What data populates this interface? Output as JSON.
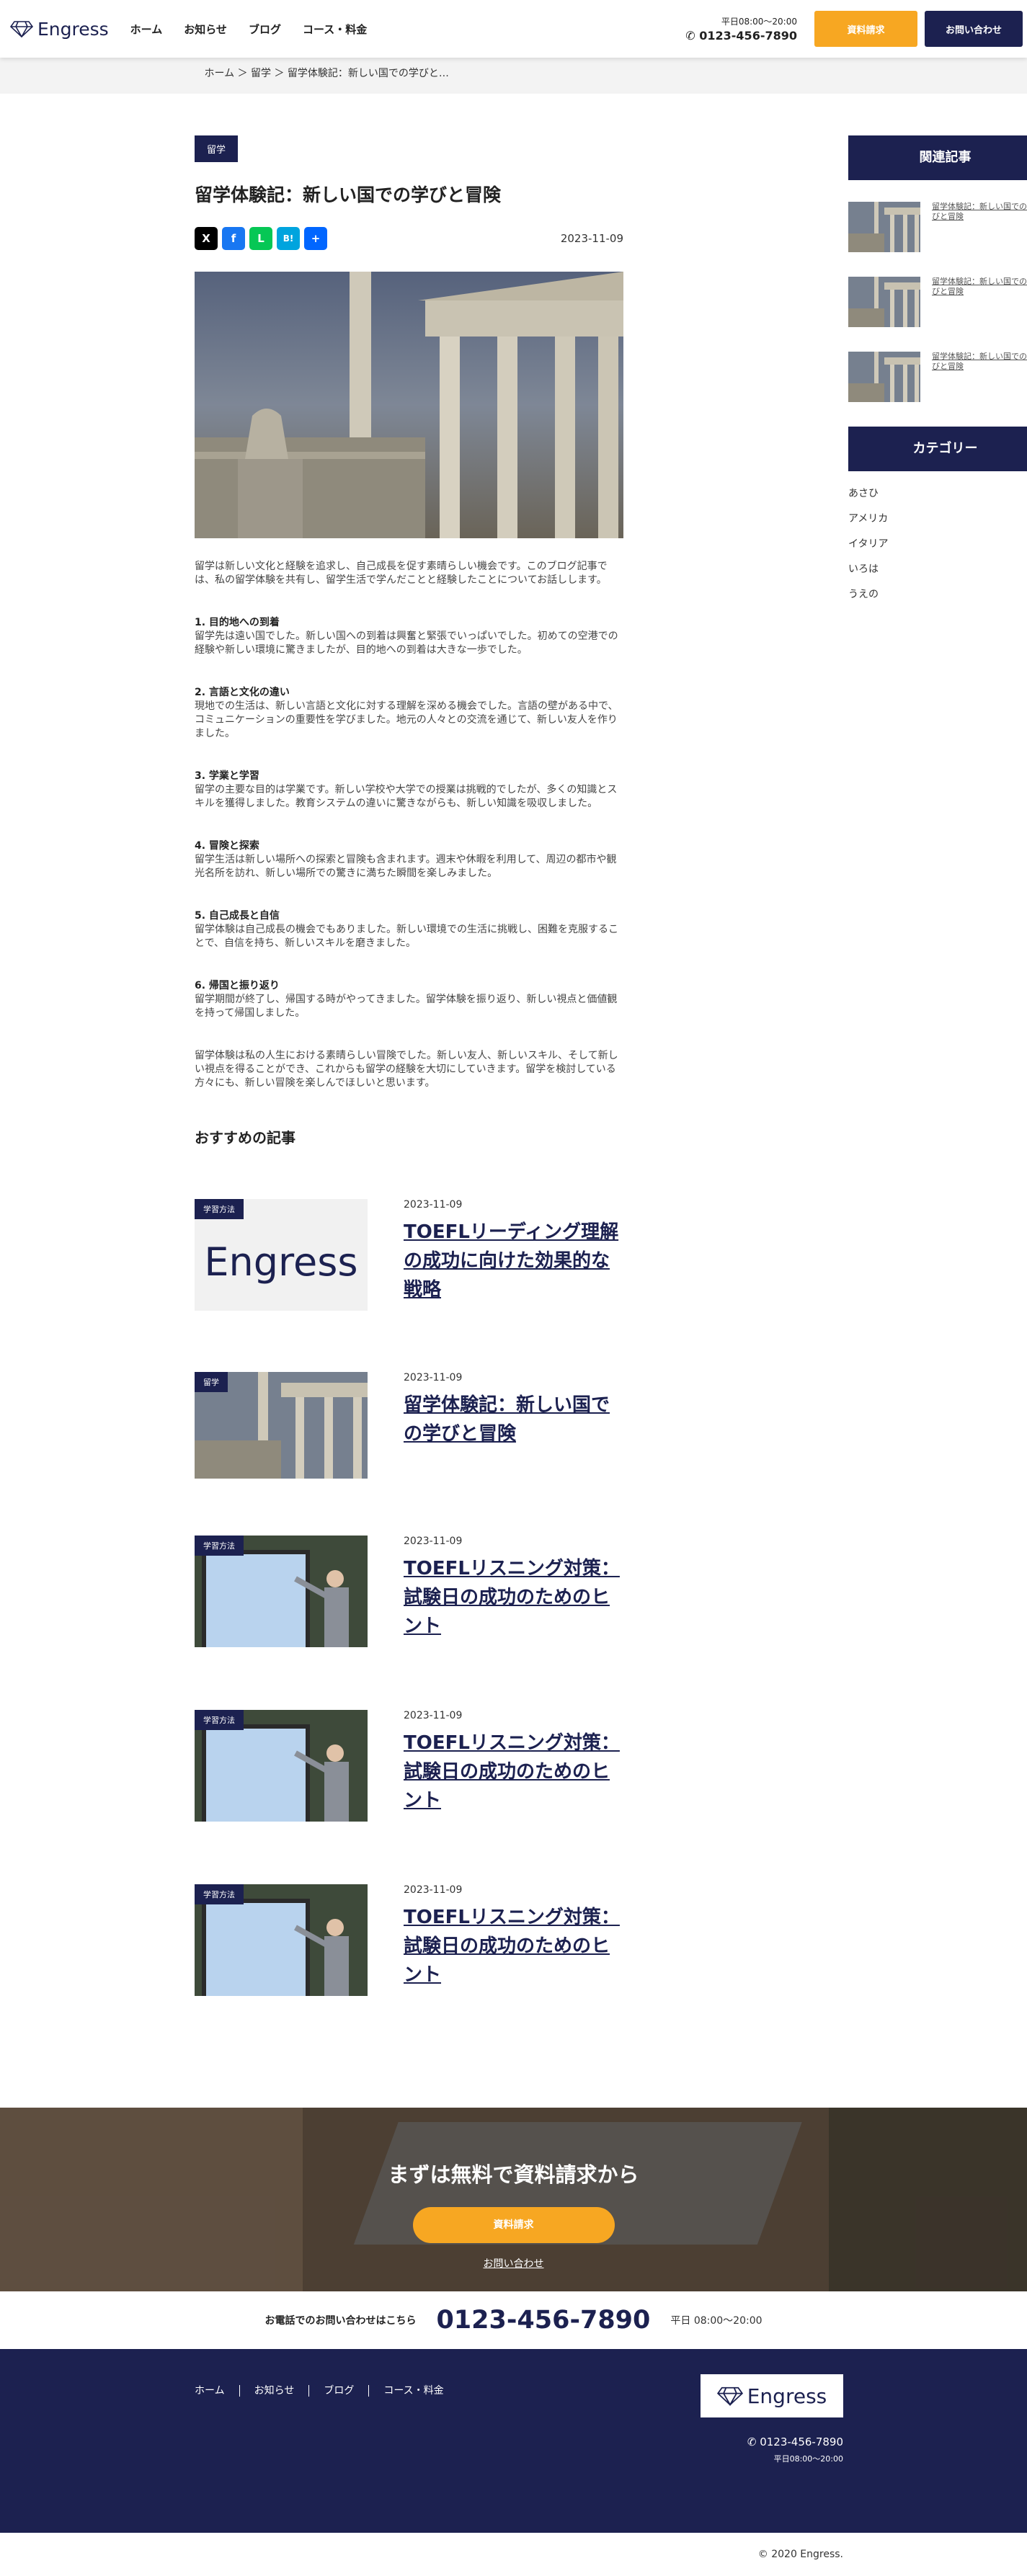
{
  "header": {
    "logo": "Engress",
    "nav": [
      "ホーム",
      "お知らせ",
      "ブログ",
      "コース・料金"
    ],
    "hours": "平日08:00～20:00",
    "tel": "0123-456-7890",
    "btn_docs": "資料請求",
    "btn_contact": "お問い合わせ"
  },
  "breadcrumb": "ホーム ＞ 留学 ＞ 留学体験記：新しい国での学びと…",
  "article": {
    "category": "留学",
    "title": "留学体験記：新しい国での学びと冒険",
    "date": "2023-11-09",
    "share": [
      "X",
      "f",
      "L",
      "B!",
      "+"
    ],
    "intro": "留学は新しい文化と経験を追求し、自己成長を促す素晴らしい機会です。このブログ記事では、私の留学体験を共有し、留学生活で学んだことと経験したことについてお話しします。",
    "sections": [
      {
        "heading": "1. 目的地への到着",
        "text": "留学先は遠い国でした。新しい国への到着は興奮と緊張でいっぱいでした。初めての空港での経験や新しい環境に驚きましたが、目的地への到着は大きな一歩でした。"
      },
      {
        "heading": "2. 言語と文化の違い",
        "text": "現地での生活は、新しい言語と文化に対する理解を深める機会でした。言語の壁がある中で、コミュニケーションの重要性を学びました。地元の人々との交流を通じて、新しい友人を作りました。"
      },
      {
        "heading": "3. 学業と学習",
        "text": "留学の主要な目的は学業です。新しい学校や大学での授業は挑戦的でしたが、多くの知識とスキルを獲得しました。教育システムの違いに驚きながらも、新しい知識を吸収しました。"
      },
      {
        "heading": "4. 冒険と探索",
        "text": "留学生活は新しい場所への探索と冒険も含まれます。週末や休暇を利用して、周辺の都市や観光名所を訪れ、新しい場所での驚きに満ちた瞬間を楽しみました。"
      },
      {
        "heading": "5. 自己成長と自信",
        "text": "留学体験は自己成長の機会でもありました。新しい環境での生活に挑戦し、困難を克服することで、自信を持ち、新しいスキルを磨きました。"
      },
      {
        "heading": "6. 帰国と振り返り",
        "text": "留学期間が終了し、帰国する時がやってきました。留学体験を振り返り、新しい視点と価値観を持って帰国しました。"
      }
    ],
    "outro": "留学体験は私の人生における素晴らしい冒険でした。新しい友人、新しいスキル、そして新しい視点を得ることができ、これからも留学の経験を大切にしていきます。留学を検討している方々にも、新しい冒険を楽しんでほしいと思います。"
  },
  "sidebar": {
    "related_title": "関連記事",
    "related": [
      "留学体験記：新しい国での学びと冒険",
      "留学体験記：新しい国での学びと冒険",
      "留学体験記：新しい国での学びと冒険"
    ],
    "category_title": "カテゴリー",
    "categories": [
      "あさひ",
      "アメリカ",
      "イタリア",
      "いろは",
      "うえの"
    ]
  },
  "recommend": {
    "title": "おすすめの記事",
    "items": [
      {
        "tag": "学習方法",
        "date": "2023-11-09",
        "title": "TOEFLリーディング理解の成功に向けた効果的な戦略",
        "thumb": "logo",
        "thumb_text": "Engress"
      },
      {
        "tag": "留学",
        "date": "2023-11-09",
        "title": "留学体験記：新しい国での学びと冒険",
        "thumb": "temple"
      },
      {
        "tag": "学習方法",
        "date": "2023-11-09",
        "title": "TOEFLリスニング対策：試験日の成功のためのヒント",
        "thumb": "class"
      },
      {
        "tag": "学習方法",
        "date": "2023-11-09",
        "title": "TOEFLリスニング対策：試験日の成功のためのヒント",
        "thumb": "class"
      },
      {
        "tag": "学習方法",
        "date": "2023-11-09",
        "title": "TOEFLリスニング対策：試験日の成功のためのヒント",
        "thumb": "class"
      }
    ]
  },
  "cta": {
    "title": "まずは無料で資料請求から",
    "button": "資料請求",
    "link": "お問い合わせ"
  },
  "telbar": {
    "label": "お電話でのお問い合わせはこちら",
    "number": "0123-456-7890",
    "hours": "平日 08:00～20:00"
  },
  "footer": {
    "nav": [
      "ホーム",
      "お知らせ",
      "ブログ",
      "コース・料金"
    ],
    "logo": "Engress",
    "tel": "0123-456-7890",
    "hours": "平日08:00～20:00",
    "copyright": "© 2020 Engress."
  },
  "colors": {
    "navy": "#1c2150",
    "orange": "#f7a722"
  }
}
